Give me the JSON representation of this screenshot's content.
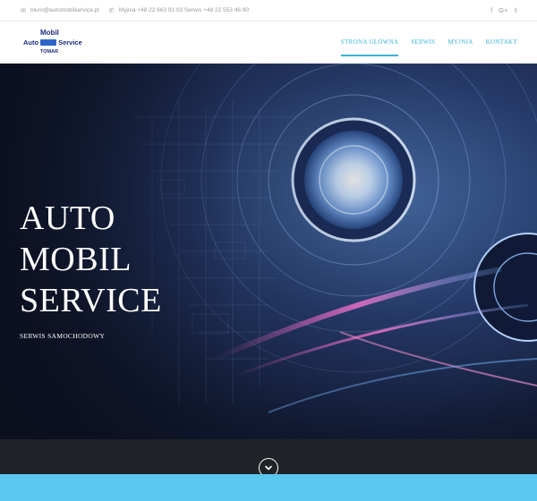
{
  "topbar": {
    "email": "biuro@automobilservice.pl",
    "phone_text": "Myjnia +48 22 663 93 03  Serwis +48 22 553 46 90",
    "icons": {
      "email": "envelope-icon",
      "phone": "phone-icon"
    },
    "social": [
      "facebook-icon",
      "google-plus-icon",
      "twitter-icon"
    ]
  },
  "logo": {
    "line1": "Mobil",
    "line2_left": "Auto",
    "line2_right": "Service",
    "line3": "TOMAR"
  },
  "nav": {
    "items": [
      {
        "label": "STRONA GŁÓWNA",
        "active": true
      },
      {
        "label": "SERWIS",
        "active": false
      },
      {
        "label": "MYJNIA",
        "active": false
      },
      {
        "label": "KONTAKT",
        "active": false
      }
    ]
  },
  "hero": {
    "title_lines": [
      "AUTO",
      "MOBIL",
      "SERVICE"
    ],
    "subtitle": "SERWIS SAMOCHODOWY"
  },
  "colors": {
    "accent": "#3bb3d9",
    "strip": "#1f2226",
    "bottom_band": "#5ac8f0"
  },
  "scroll_icon": "chevron-down-icon"
}
